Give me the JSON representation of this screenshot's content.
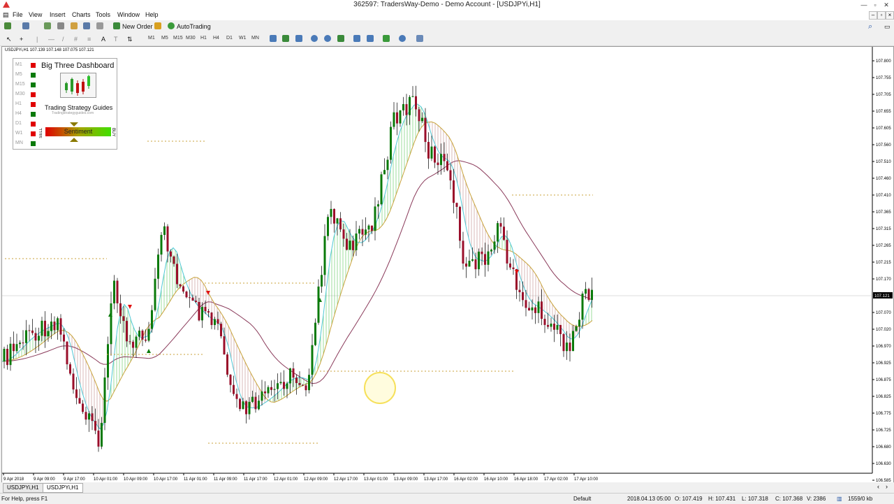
{
  "window": {
    "title": "362597: TradersWay-Demo - Demo Account - [USDJPYi,H1]",
    "buttons": [
      "—",
      "▫",
      "✕"
    ]
  },
  "menu": [
    "File",
    "View",
    "Insert",
    "Charts",
    "Tools",
    "Window",
    "Help"
  ],
  "toolbar": {
    "new_order": "New Order",
    "autotrading": "AutoTrading",
    "timeframes": [
      "M1",
      "M5",
      "M15",
      "M30",
      "H1",
      "H4",
      "D1",
      "W1",
      "MN"
    ]
  },
  "chart": {
    "label": "USDJPYi,H1  107.139 107.148 107.075 107.121",
    "current_price": "107.121",
    "price_labels": [
      "107.800",
      "107.755",
      "107.705",
      "107.655",
      "107.605",
      "107.560",
      "107.510",
      "107.460",
      "107.410",
      "107.365",
      "107.315",
      "107.265",
      "107.215",
      "107.170",
      "107.121",
      "107.070",
      "107.020",
      "106.970",
      "106.925",
      "106.875",
      "106.825",
      "106.775",
      "106.725",
      "106.680",
      "106.630",
      "106.585"
    ],
    "time_labels": [
      "9 Apr 2018",
      "9 Apr 09:00",
      "9 Apr 17:00",
      "10 Apr 01:00",
      "10 Apr 09:00",
      "10 Apr 17:00",
      "11 Apr 01:00",
      "11 Apr 09:00",
      "11 Apr 17:00",
      "12 Apr 01:00",
      "12 Apr 09:00",
      "12 Apr 17:00",
      "13 Apr 01:00",
      "13 Apr 09:00",
      "13 Apr 17:00",
      "16 Apr 02:00",
      "16 Apr 10:00",
      "16 Apr 18:00",
      "17 Apr 02:00",
      "17 Apr 10:00"
    ],
    "colors": {
      "bull": "#0a7a0a",
      "bear": "#9a0e2a",
      "fast_ma": "#4fc8d6",
      "slow_ma": "#c8a23a",
      "long_ma": "#8a3a5a",
      "band_up": "#33bb33",
      "band_down": "#b07070"
    }
  },
  "dashboard": {
    "title": "Big Three Dashboard",
    "subtitle": "Trading Strategy Guides",
    "url": "Tradingstrategyguides.com",
    "sentiment": "Sentiment",
    "sell": "SELL",
    "buy": "BUY",
    "rows": [
      {
        "tf": "M1",
        "color": "#e00000"
      },
      {
        "tf": "M5",
        "color": "#0a7a0a"
      },
      {
        "tf": "M15",
        "color": "#0a7a0a"
      },
      {
        "tf": "M30",
        "color": "#e00000"
      },
      {
        "tf": "H1",
        "color": "#e00000"
      },
      {
        "tf": "H4",
        "color": "#0a7a0a"
      },
      {
        "tf": "D1",
        "color": "#e00000"
      },
      {
        "tf": "W1",
        "color": "#e00000"
      },
      {
        "tf": "MN",
        "color": "#0a7a0a"
      }
    ]
  },
  "tabs": [
    "USDJPYi,H1",
    "USDJPYi,H1"
  ],
  "status": {
    "help": "For Help, press F1",
    "profile": "Default",
    "time": "2018.04.13 05:00",
    "open": "O: 107.419",
    "high": "H: 107.431",
    "low": "L: 107.318",
    "close": "C: 107.368",
    "volume": "V: 2386",
    "traffic": "1559/0 kb"
  }
}
